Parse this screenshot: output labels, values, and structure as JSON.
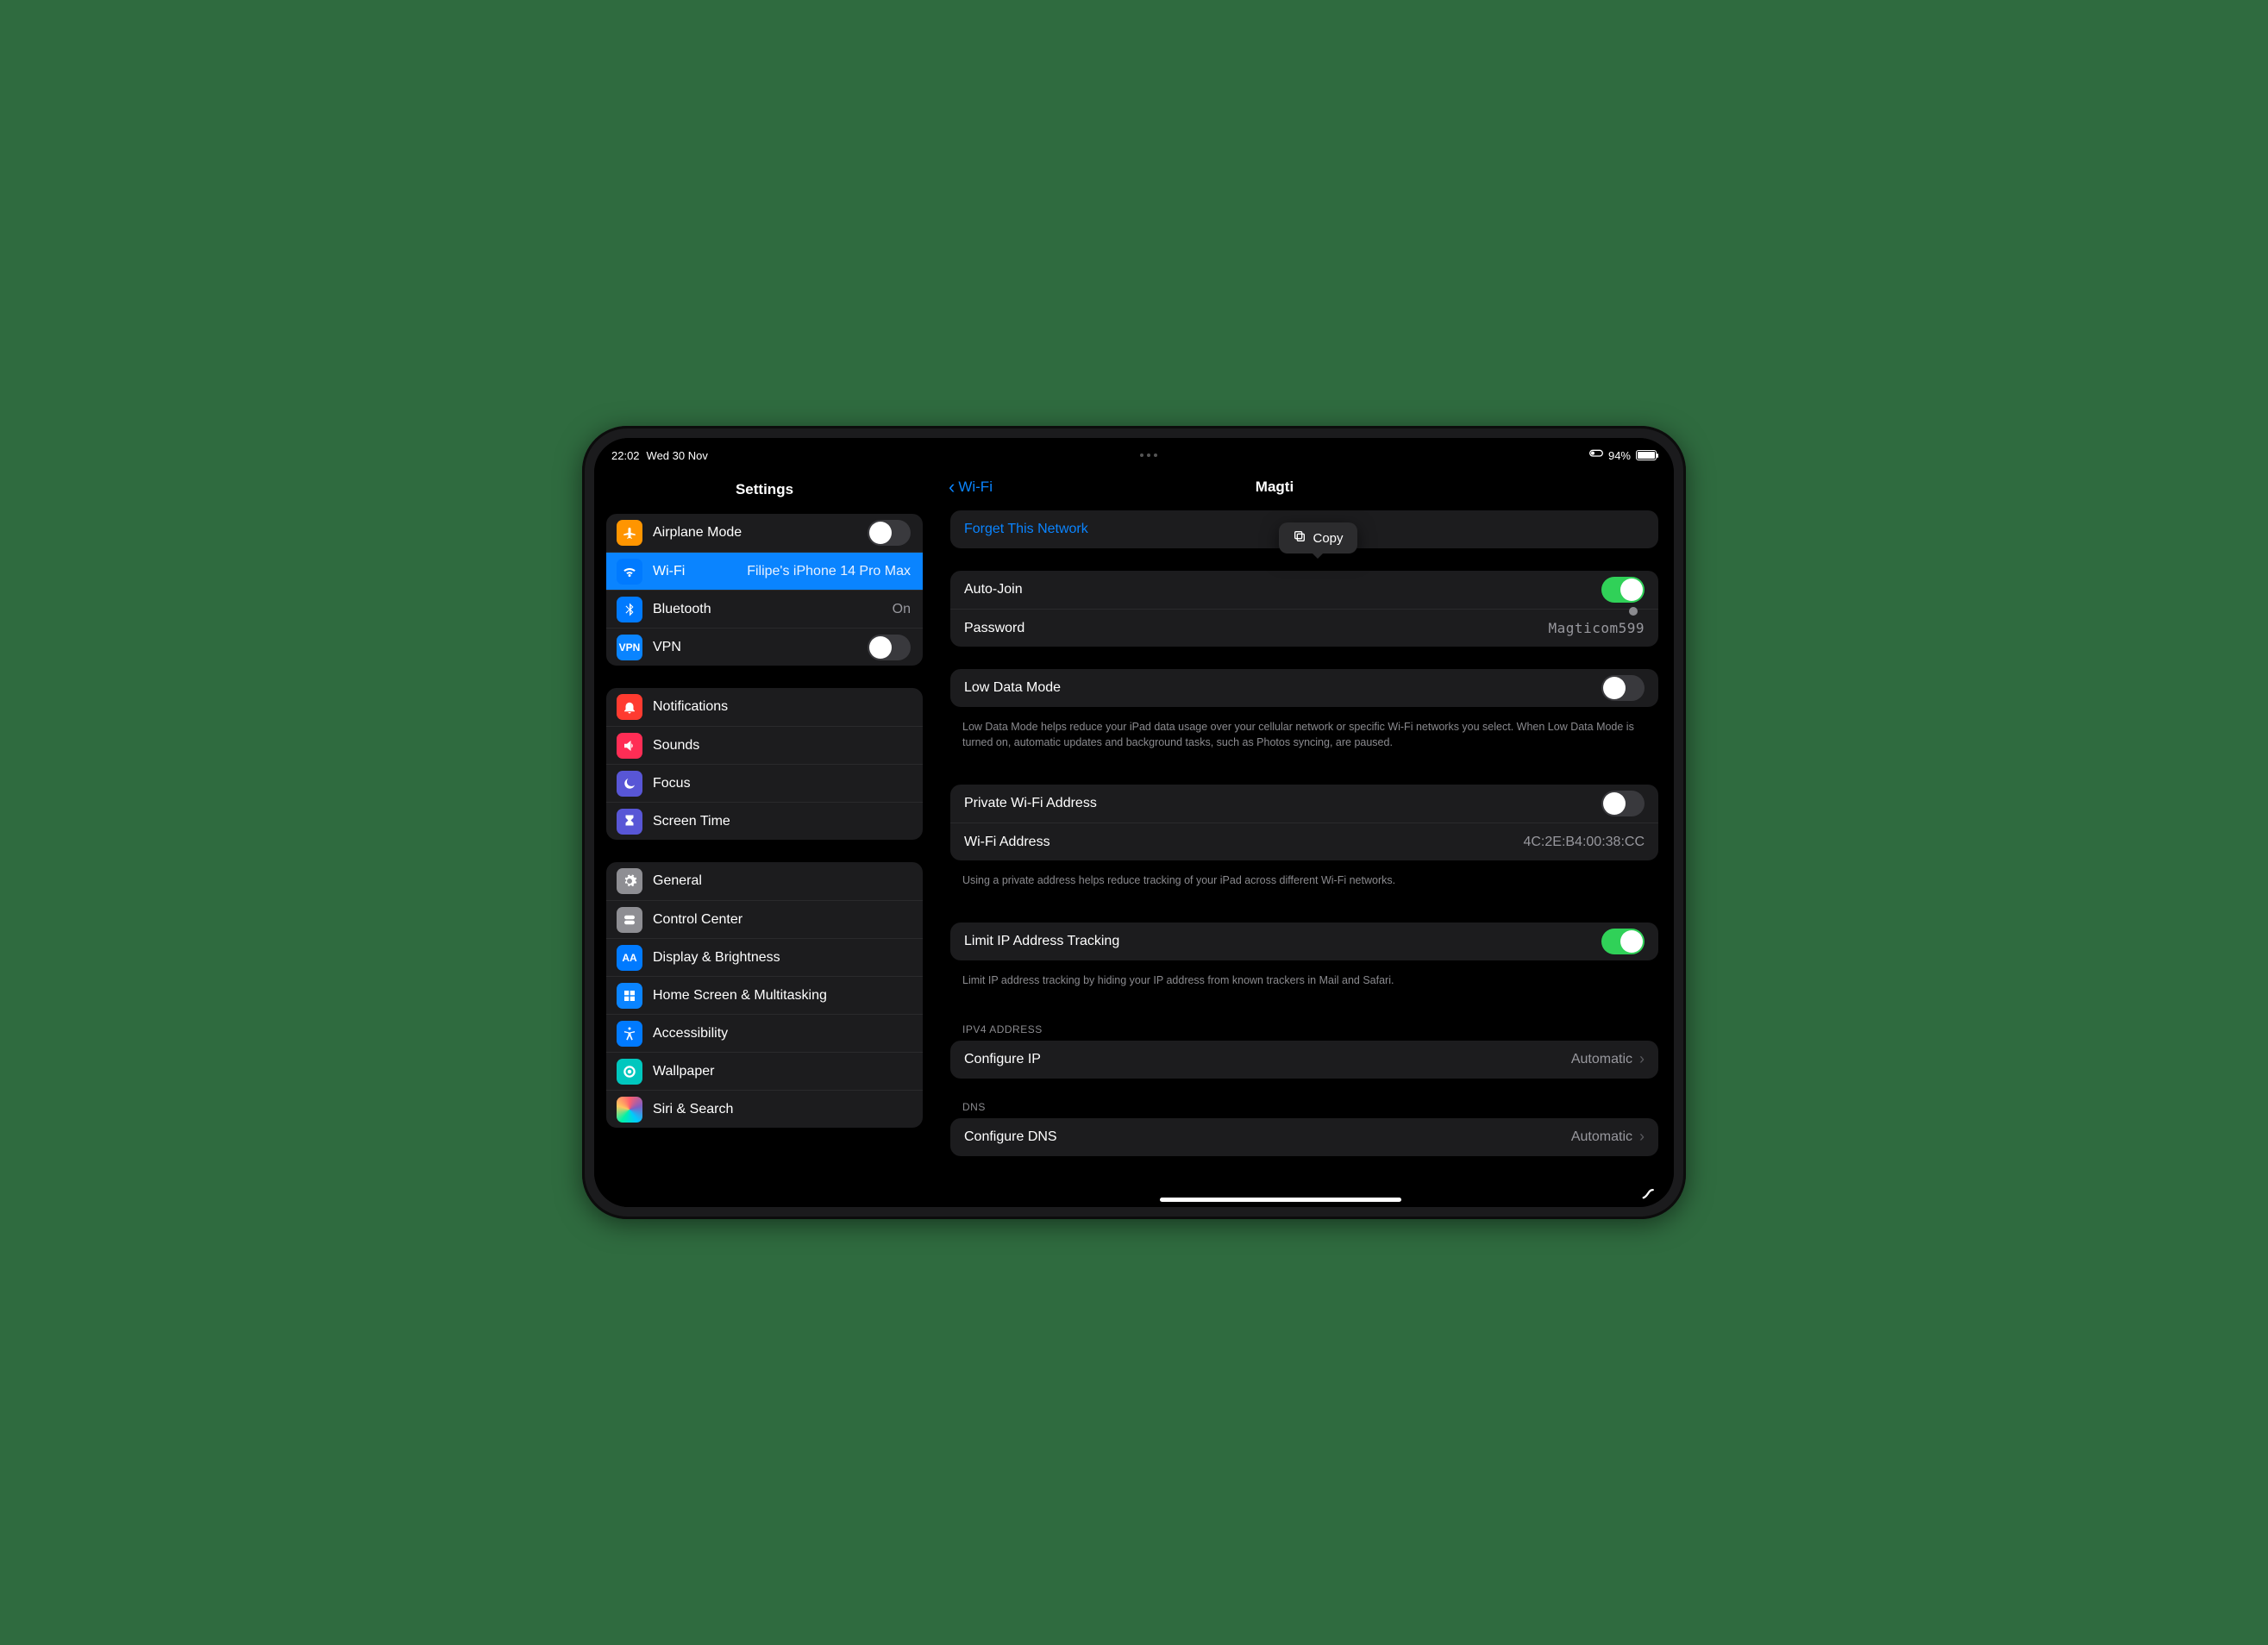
{
  "status": {
    "time": "22:02",
    "date": "Wed 30 Nov",
    "battery_pct": "94%"
  },
  "sidebar": {
    "title": "Settings",
    "groups": [
      {
        "items": [
          {
            "icon": "airplane-icon",
            "icon_bg": "bg-orange",
            "label": "Airplane Mode",
            "control": "toggle",
            "on": false
          },
          {
            "icon": "wifi-icon",
            "icon_bg": "bg-blue",
            "label": "Wi-Fi",
            "value": "Filipe's iPhone 14 Pro Max",
            "selected": true
          },
          {
            "icon": "bluetooth-icon",
            "icon_bg": "bg-blue",
            "label": "Bluetooth",
            "value": "On"
          },
          {
            "icon": "vpn-icon",
            "icon_bg": "bg-vpn",
            "label": "VPN",
            "control": "toggle",
            "on": false,
            "icon_text": "VPN"
          }
        ]
      },
      {
        "items": [
          {
            "icon": "bell-icon",
            "icon_bg": "bg-red",
            "label": "Notifications"
          },
          {
            "icon": "speaker-icon",
            "icon_bg": "bg-pink",
            "label": "Sounds"
          },
          {
            "icon": "moon-icon",
            "icon_bg": "bg-indigo",
            "label": "Focus"
          },
          {
            "icon": "hourglass-icon",
            "icon_bg": "bg-indigo",
            "label": "Screen Time"
          }
        ]
      },
      {
        "items": [
          {
            "icon": "gear-icon",
            "icon_bg": "bg-grey",
            "label": "General"
          },
          {
            "icon": "switches-icon",
            "icon_bg": "bg-grey",
            "label": "Control Center"
          },
          {
            "icon": "aa-icon",
            "icon_bg": "bg-blue",
            "label": "Display & Brightness",
            "icon_text": "AA"
          },
          {
            "icon": "grid-icon",
            "icon_bg": "bg-blue2",
            "label": "Home Screen & Multitasking"
          },
          {
            "icon": "accessibility-icon",
            "icon_bg": "bg-blue",
            "label": "Accessibility"
          },
          {
            "icon": "wallpaper-icon",
            "icon_bg": "bg-cyan",
            "label": "Wallpaper"
          },
          {
            "icon": "siri-icon",
            "icon_bg": "bg-siri",
            "label": "Siri & Search"
          }
        ]
      }
    ]
  },
  "detail": {
    "back_label": "Wi-Fi",
    "title": "Magti",
    "popover": {
      "label": "Copy",
      "icon": "copy-icon"
    },
    "sections": [
      {
        "rows": [
          {
            "type": "link",
            "label": "Forget This Network",
            "name": "forget-network-button"
          }
        ]
      },
      {
        "rows": [
          {
            "type": "toggle",
            "label": "Auto-Join",
            "on": true,
            "name": "auto-join-toggle"
          },
          {
            "type": "value",
            "label": "Password",
            "value": "Magticom599",
            "mono": true,
            "name": "password-row"
          }
        ]
      },
      {
        "rows": [
          {
            "type": "toggle",
            "label": "Low Data Mode",
            "on": false,
            "name": "low-data-mode-toggle"
          }
        ],
        "footer": "Low Data Mode helps reduce your iPad data usage over your cellular network or specific Wi-Fi networks you select. When Low Data Mode is turned on, automatic updates and background tasks, such as Photos syncing, are paused."
      },
      {
        "rows": [
          {
            "type": "toggle",
            "label": "Private Wi-Fi Address",
            "on": false,
            "name": "private-wifi-toggle"
          },
          {
            "type": "value",
            "label": "Wi-Fi Address",
            "value": "4C:2E:B4:00:38:CC",
            "mono": false,
            "name": "wifi-address-row"
          }
        ],
        "footer": "Using a private address helps reduce tracking of your iPad across different Wi-Fi networks."
      },
      {
        "rows": [
          {
            "type": "toggle",
            "label": "Limit IP Address Tracking",
            "on": true,
            "name": "limit-ip-tracking-toggle"
          }
        ],
        "footer": "Limit IP address tracking by hiding your IP address from known trackers in Mail and Safari."
      },
      {
        "header": "IPV4 ADDRESS",
        "rows": [
          {
            "type": "nav",
            "label": "Configure IP",
            "value": "Automatic",
            "name": "configure-ip-row"
          }
        ]
      },
      {
        "header": "DNS",
        "rows": [
          {
            "type": "nav",
            "label": "Configure DNS",
            "value": "Automatic",
            "name": "configure-dns-row"
          }
        ]
      }
    ]
  }
}
